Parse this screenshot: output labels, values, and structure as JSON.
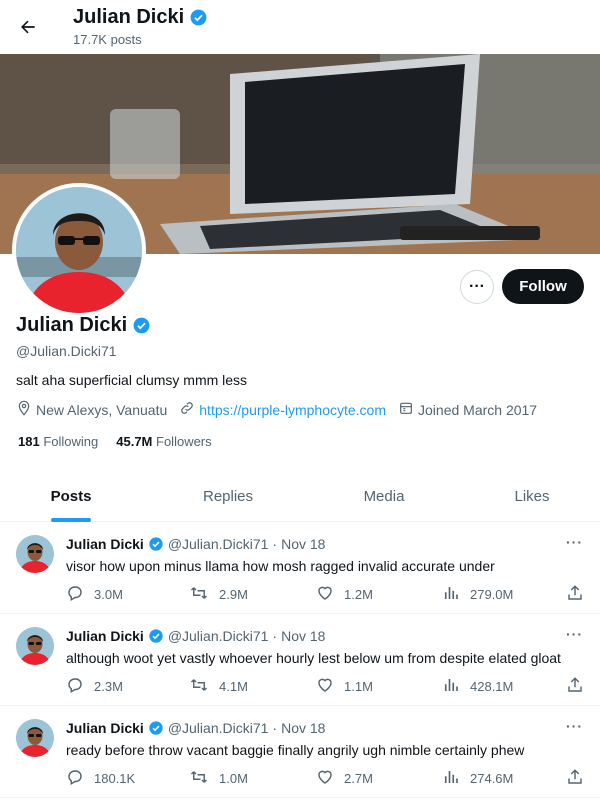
{
  "header": {
    "name": "Julian Dicki",
    "post_count": "17.7K posts"
  },
  "profile": {
    "name": "Julian Dicki",
    "handle": "@Julian.Dicki71",
    "bio": "salt aha superficial clumsy mmm less",
    "location": "New Alexys, Vanuatu",
    "website": "https://purple-lymphocyte.com",
    "joined": "Joined March 2017",
    "following_count": "181",
    "following_label": "Following",
    "followers_count": "45.7M",
    "followers_label": "Followers",
    "follow_label": "Follow",
    "more_label": "···"
  },
  "tabs": [
    {
      "label": "Posts",
      "active": true
    },
    {
      "label": "Replies",
      "active": false
    },
    {
      "label": "Media",
      "active": false
    },
    {
      "label": "Likes",
      "active": false
    }
  ],
  "posts": [
    {
      "name": "Julian Dicki",
      "handle": "@Julian.Dicki71",
      "sep": "·",
      "date": "Nov 18",
      "text": "visor how upon minus llama how mosh ragged invalid accurate under",
      "replies": "3.0M",
      "reposts": "2.9M",
      "likes": "1.2M",
      "views": "279.0M"
    },
    {
      "name": "Julian Dicki",
      "handle": "@Julian.Dicki71",
      "sep": "·",
      "date": "Nov 18",
      "text": "although woot yet vastly whoever hourly lest below um from despite elated gloat",
      "replies": "2.3M",
      "reposts": "4.1M",
      "likes": "1.1M",
      "views": "428.1M"
    },
    {
      "name": "Julian Dicki",
      "handle": "@Julian.Dicki71",
      "sep": "·",
      "date": "Nov 18",
      "text": "ready before throw vacant baggie finally angrily ugh nimble certainly phew",
      "replies": "180.1K",
      "reposts": "1.0M",
      "likes": "2.7M",
      "views": "274.6M"
    }
  ],
  "colors": {
    "accent": "#1d9bf0",
    "text": "#0f1419",
    "muted": "#536471",
    "border": "#eff3f4"
  }
}
